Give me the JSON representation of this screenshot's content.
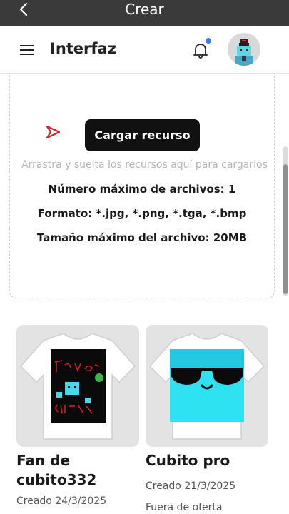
{
  "topbar": {
    "title": "Crear",
    "back_icon": "chevron-left-icon"
  },
  "header": {
    "title": "Interfaz",
    "menu_icon": "hamburger-menu-icon",
    "bell_icon": "bell-icon",
    "notification_color": "#3f7cf6"
  },
  "upload": {
    "button_label": "Cargar recurso",
    "hint": "Arrastra y suelta los recursos aquí para cargarlos",
    "max_files": "Número máximo de archivos: 1",
    "formats": "Formato: *.jpg, *.png, *.tga, *.bmp",
    "max_size": "Tamaño máximo del archivo: 20MB",
    "icon": "play-icon",
    "accent_color": "#d6202a"
  },
  "items": [
    {
      "title": "Fan de cubito332",
      "meta": "Creado 24/3/2025",
      "status": ""
    },
    {
      "title": "Cubito pro",
      "meta": "Creado 21/3/2025",
      "status": "Fuera de oferta"
    }
  ]
}
